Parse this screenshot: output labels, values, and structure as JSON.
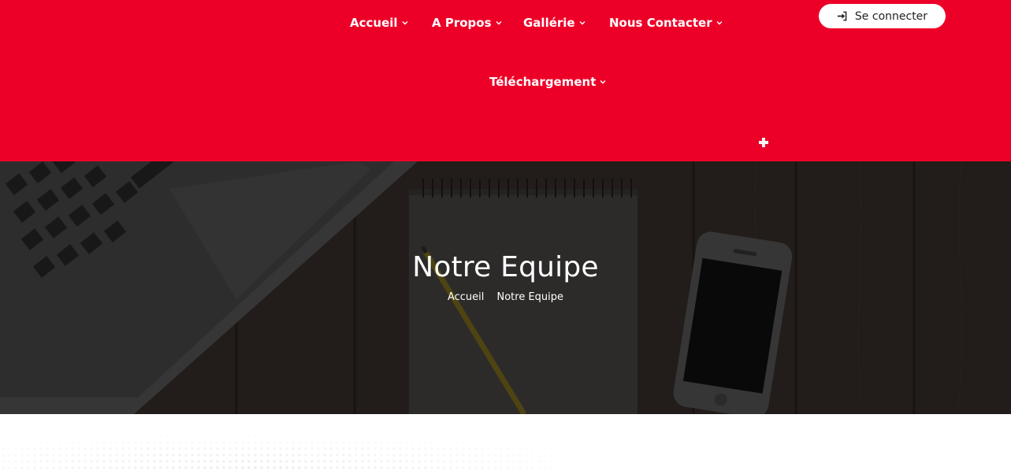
{
  "nav": {
    "items": [
      {
        "label": "Accueil"
      },
      {
        "label": "A Propos"
      },
      {
        "label": "Gallérie"
      },
      {
        "label": "Nous Contacter"
      },
      {
        "label": "Téléchargement"
      }
    ]
  },
  "login": {
    "label": "Se connecter"
  },
  "hero": {
    "title": "Notre Equipe",
    "breadcrumb": [
      "Accueil",
      "Notre Equipe"
    ]
  },
  "colors": {
    "brand_red": "#ec0028",
    "hero_overlay": "#1c1a18",
    "white": "#ffffff"
  },
  "icons": {
    "nav_dropdown": "chevron-down-icon",
    "login": "sign-in-icon",
    "expand": "plus-icon"
  }
}
